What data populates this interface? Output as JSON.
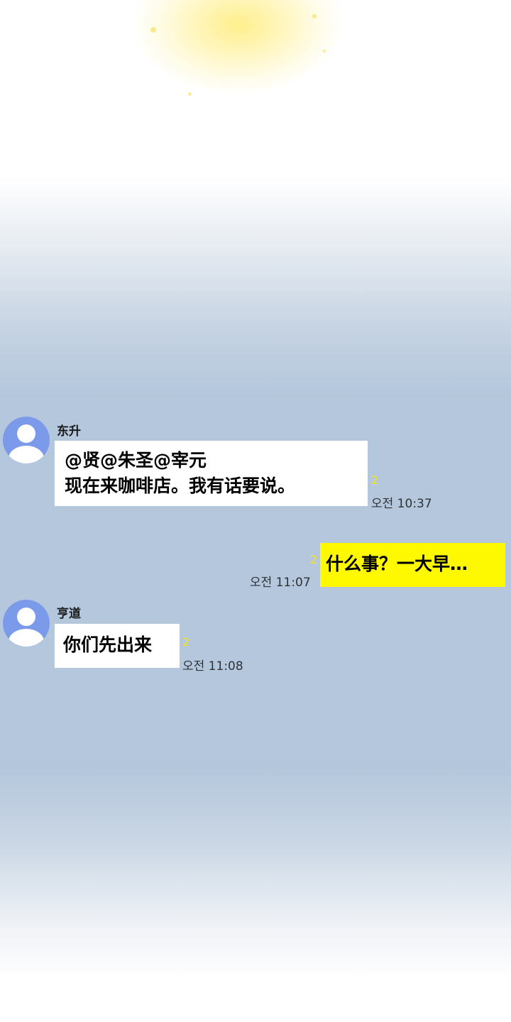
{
  "colors": {
    "outgoing_bubble": "#fff900",
    "incoming_bubble": "#ffffff",
    "unread_count": "#f3e21e",
    "avatar": "#7b9bea"
  },
  "icons": {
    "avatar": "default-avatar-icon"
  },
  "messages": [
    {
      "sender": "东升",
      "lines": [
        "@贤@朱圣@宰元",
        "现在来咖啡店。我有话要说。"
      ],
      "unread": "2",
      "time": "오전 10:37",
      "direction": "incoming"
    },
    {
      "sender": "",
      "lines": [
        "什么事？一大早…"
      ],
      "unread": "2",
      "time": "오전 11:07",
      "direction": "outgoing"
    },
    {
      "sender": "亨道",
      "lines": [
        "你们先出来"
      ],
      "unread": "2",
      "time": "오전 11:08",
      "direction": "incoming"
    }
  ]
}
